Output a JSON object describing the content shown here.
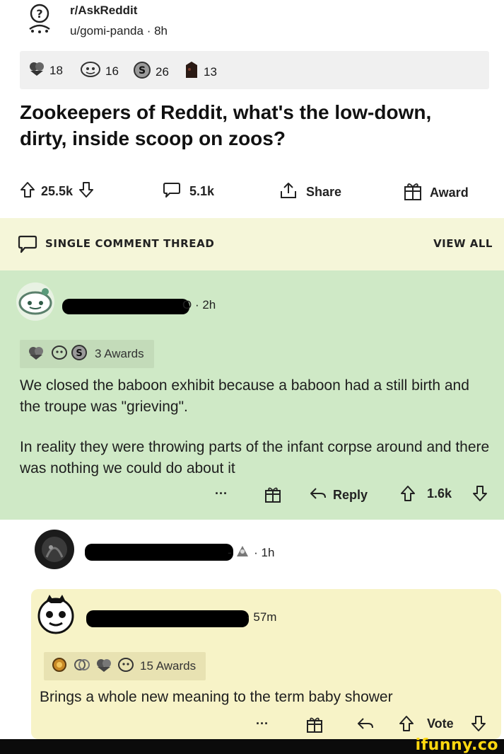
{
  "post": {
    "subreddit": "r/AskReddit",
    "author": "u/gomi-panda",
    "age": "8h",
    "awards": [
      {
        "icon": "wholesome-award-icon",
        "count": "18"
      },
      {
        "icon": "helpful-award-icon",
        "count": "16"
      },
      {
        "icon": "silver-award-icon",
        "count": "26"
      },
      {
        "icon": "dark-award-icon",
        "count": "13"
      }
    ],
    "title": "Zookeepers of Reddit, what's the low-down, dirty, inside scoop on zoos?",
    "upvotes": "25.5k",
    "comments": "5.1k",
    "share_label": "Share",
    "award_label": "Award"
  },
  "thread": {
    "label": "SINGLE COMMENT THREAD",
    "view_all": "VIEW ALL"
  },
  "comment1": {
    "age": "2h",
    "awards_label": "3 Awards",
    "paragraph1": "We closed the baboon exhibit because a baboon had a still birth and the troupe was \"grieving\".",
    "paragraph2": "In reality they were throwing parts of the infant corpse around and there was nothing we could do about it",
    "more": "···",
    "reply_label": "Reply",
    "votes": "1.6k"
  },
  "comment2": {
    "age": "1h"
  },
  "comment3": {
    "age": "57m",
    "awards_label": "15 Awards",
    "body": "Brings a whole new meaning to the term baby shower",
    "more": "···",
    "vote_label": "Vote"
  },
  "watermark": "ifunny.co",
  "colors": {
    "highlight_green": "#cfe9c6",
    "thread_bar": "#f5f6d9",
    "reply_yellow": "#f7f3c7",
    "watermark_yellow": "#ffd80f"
  }
}
